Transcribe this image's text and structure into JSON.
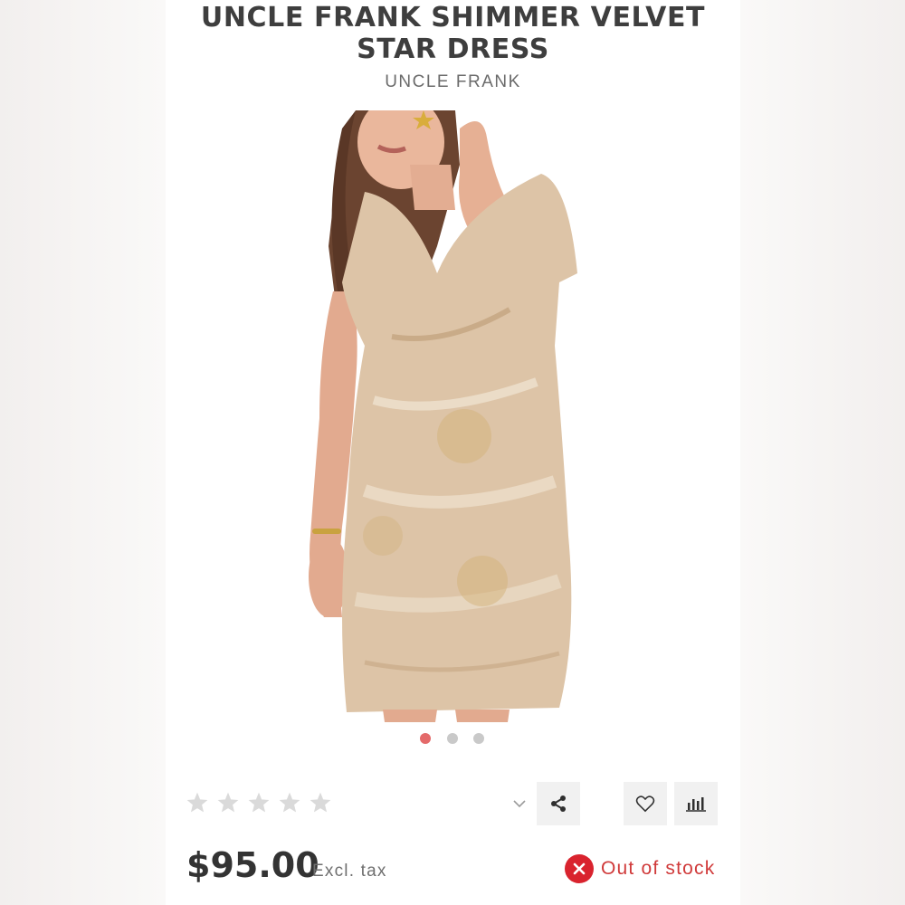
{
  "product": {
    "title_line1": "UNCLE FRANK SHIMMER VELVET",
    "title_line2": "STAR DRESS",
    "brand": "UNCLE FRANK"
  },
  "gallery": {
    "image_count": 3,
    "active_index": 0
  },
  "rating": {
    "stars": 5,
    "value": 0
  },
  "actions": {
    "dropdown_icon": "chevron-down-icon",
    "share_icon": "share-icon",
    "wishlist_icon": "heart-icon",
    "compare_icon": "bar-chart-icon"
  },
  "pricing": {
    "price": "$95.00",
    "tax_note": "Excl. tax"
  },
  "stock": {
    "label": "Out of stock",
    "icon": "close-icon"
  },
  "colors": {
    "accent": "#e46a6a",
    "stock_red": "#d9232e",
    "title": "#3e3e3e"
  }
}
